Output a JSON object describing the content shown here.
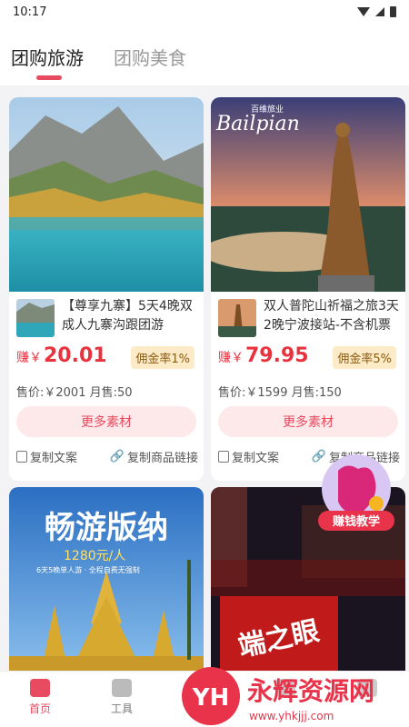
{
  "status": {
    "time": "10:17"
  },
  "tabs": [
    {
      "label": "团购旅游",
      "active": true
    },
    {
      "label": "团购美食",
      "active": false
    }
  ],
  "products": [
    {
      "title": "【尊享九寨】5天4晚双成人九寨沟跟团游",
      "earn_label": "赚￥",
      "earn_value": "20.01",
      "commission": "佣金率1%",
      "pricing": "售价:￥2001  月售:50",
      "more_button": "更多素材",
      "copy_text": "复制文案",
      "copy_link": "复制商品链接"
    },
    {
      "title": "双人普陀山祈福之旅3天2晚宁波接站-不含机票",
      "earn_label": "赚￥",
      "earn_value": "79.95",
      "commission": "佣金率5%",
      "pricing": "售价:￥1599  月售:150",
      "more_button": "更多素材",
      "copy_text": "复制文案",
      "copy_link": "复制商品链接",
      "photo_brand": "Bailpian",
      "photo_brand_cn": "百维旅业"
    },
    {
      "photo_title": "畅游版纳",
      "photo_sub1": "1280元/人",
      "photo_sub2": "6天5晚单人游 · 全程自费无强制"
    },
    {
      "photo_sign": "端之眼"
    }
  ],
  "promo_badge": "赚钱教学",
  "bottom_nav": [
    {
      "label": "首页",
      "active": true,
      "icon": "home-icon"
    },
    {
      "label": "工具",
      "active": false,
      "icon": "cube-icon"
    },
    {
      "label": "",
      "active": false,
      "icon": "center-icon"
    },
    {
      "label": "",
      "active": false,
      "icon": "nav-icon-4"
    },
    {
      "label": "",
      "active": false,
      "icon": "nav-icon-5"
    }
  ],
  "watermark": {
    "brand": "永辉资源网",
    "url": "www.yhkjjj.com"
  },
  "colors": {
    "accent": "#e84a5f",
    "earn": "#e8333f",
    "commission_bg": "#fdebc7"
  }
}
